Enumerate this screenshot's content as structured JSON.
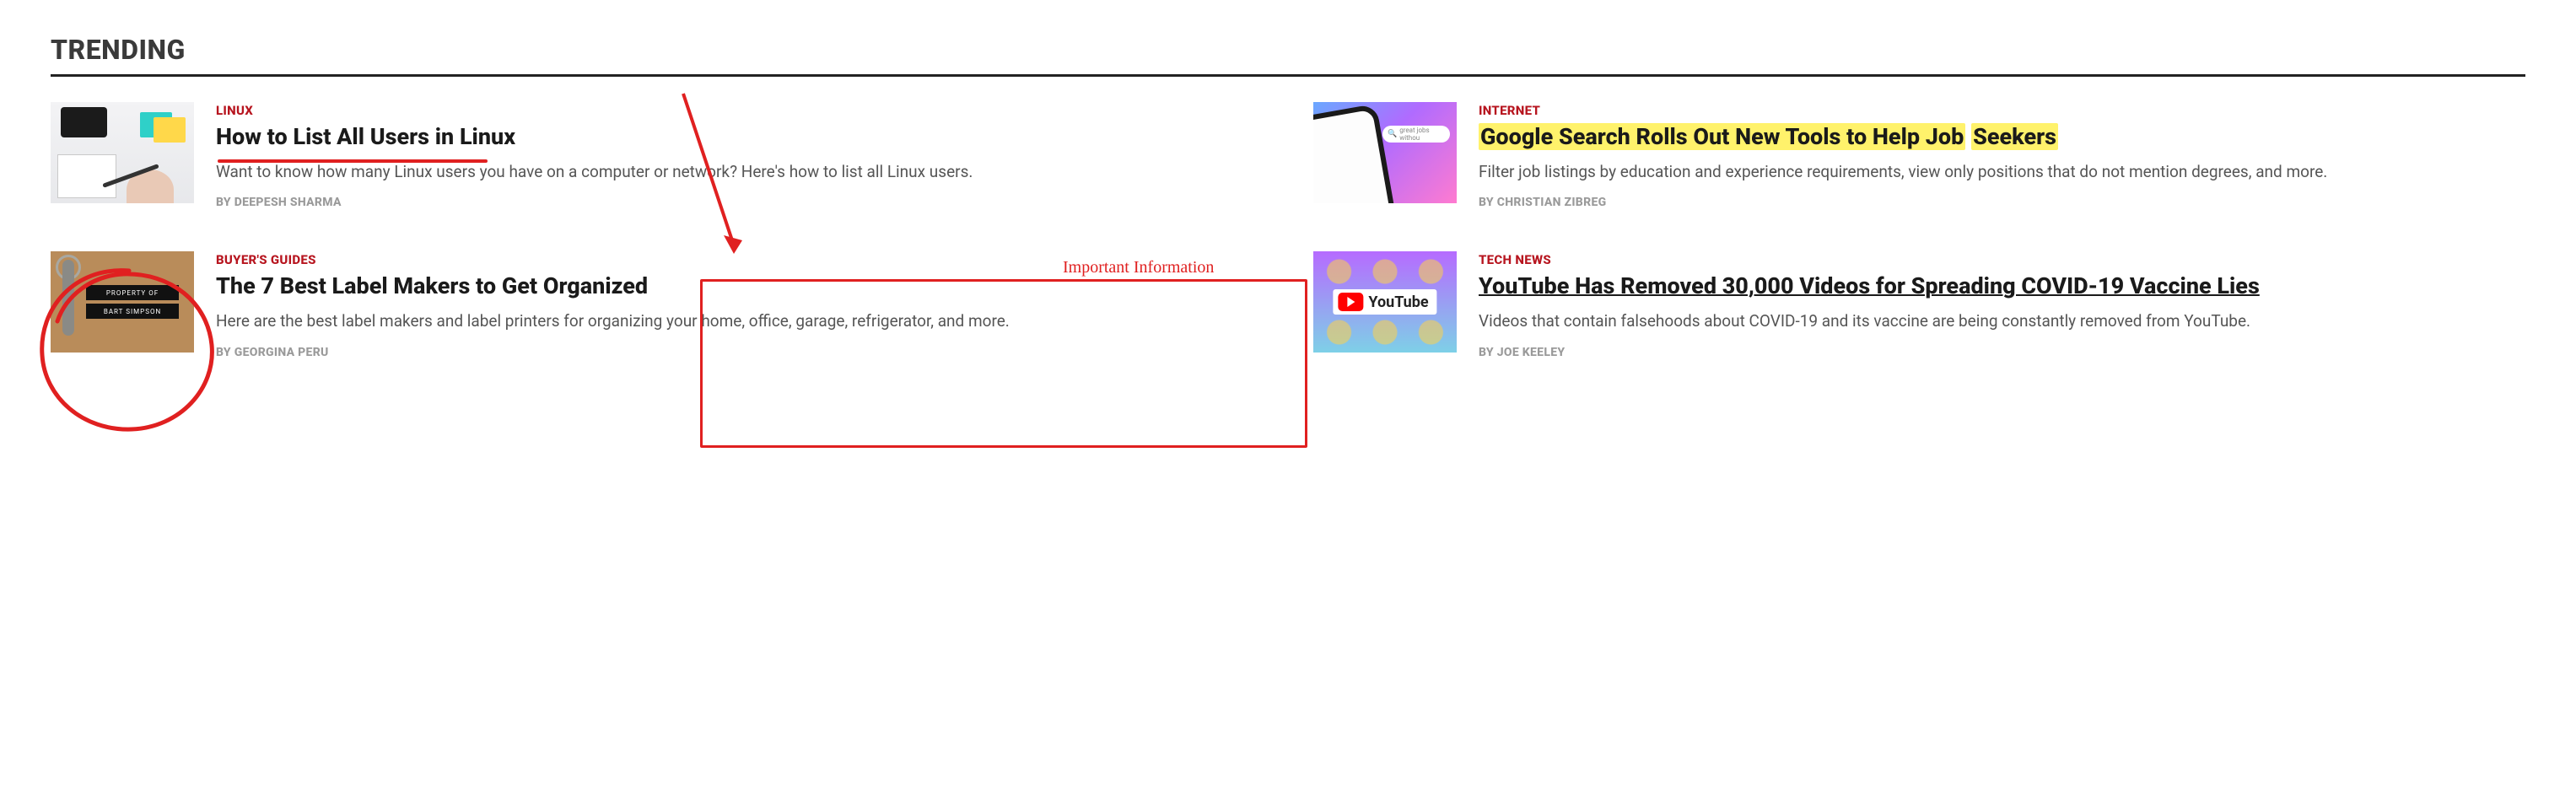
{
  "section_title": "TRENDING",
  "annotations": {
    "important_label": "Important Information",
    "search_placeholder": "great jobs withou",
    "label_strip1": "PROPERTY OF",
    "label_strip2": "BART SIMPSON",
    "yt_logo_text": "YouTube"
  },
  "articles": [
    {
      "category": "LINUX",
      "title": "How to List All Users in Linux",
      "excerpt": "Want to know how many Linux users you have on a computer or network? Here's how to list all Linux users.",
      "by": "BY ",
      "author": "DEEPESH SHARMA"
    },
    {
      "category": "INTERNET",
      "title_hl": "Google Search Rolls Out New Tools to Help Job",
      "title_tail": "Seekers",
      "excerpt": "Filter job listings by education and experience requirements, view only positions that do not mention degrees, and more.",
      "by": "BY ",
      "author": "CHRISTIAN ZIBREG"
    },
    {
      "category": "BUYER'S GUIDES",
      "title": "The 7 Best Label Makers to Get Organized",
      "excerpt": "Here are the best label makers and label printers for organizing your home, office, garage, refrigerator, and more.",
      "by": "BY ",
      "author": "GEORGINA PERU"
    },
    {
      "category": "TECH NEWS",
      "title": "YouTube Has Removed 30,000 Videos for Spreading COVID-19 Vaccine Lies",
      "excerpt": "Videos that contain falsehoods about COVID-19 and its vaccine are being constantly removed from YouTube.",
      "by": "BY ",
      "author": "JOE KEELEY"
    }
  ]
}
